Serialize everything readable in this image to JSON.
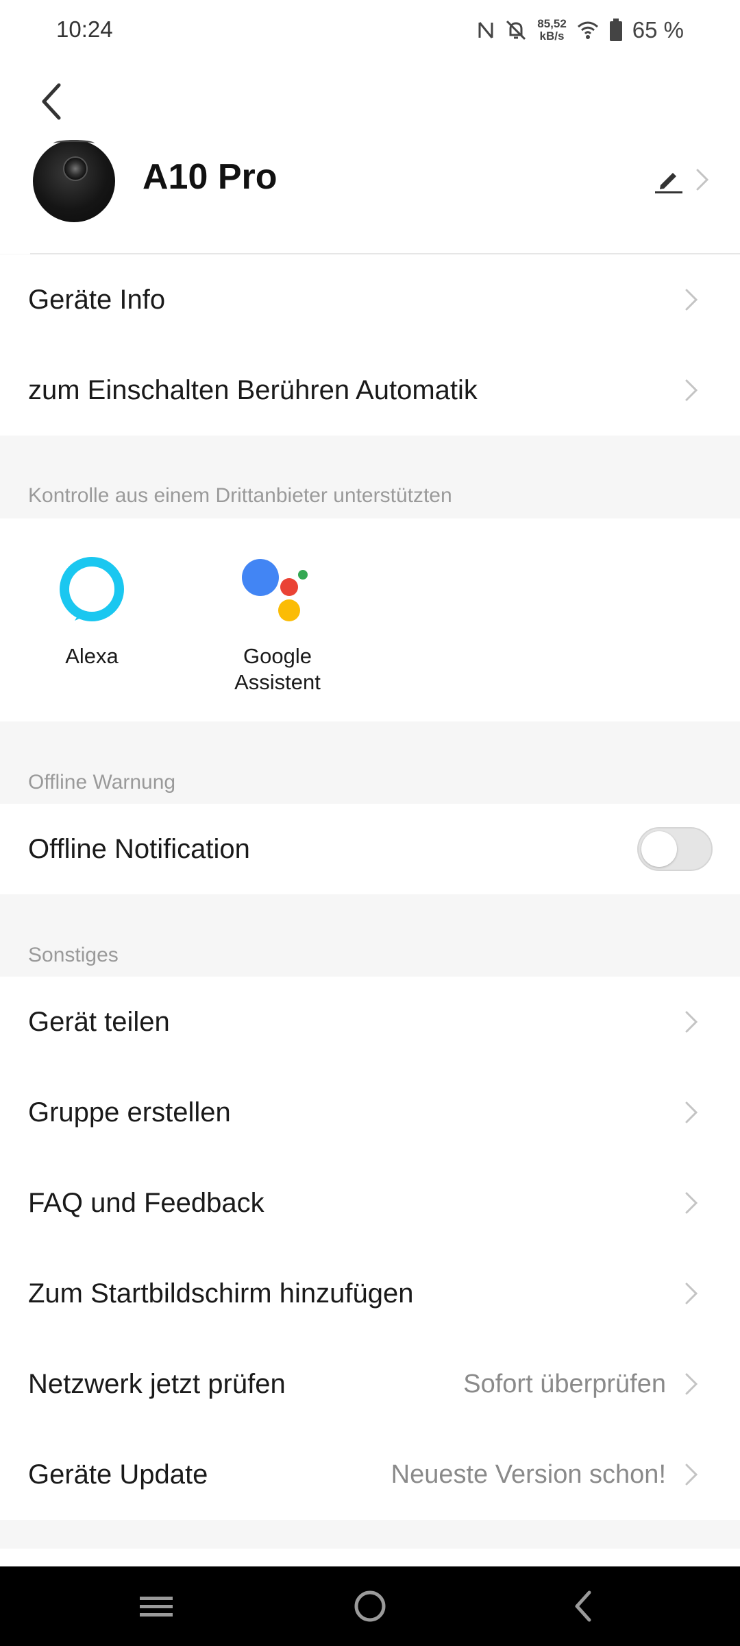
{
  "status_bar": {
    "time": "10:24",
    "speed_value": "85,52",
    "speed_unit": "kB/s",
    "battery_percent": "65 %"
  },
  "header": {
    "device_name": "A10 Pro"
  },
  "menu_top": [
    {
      "label": "Geräte Info"
    },
    {
      "label": "zum Einschalten Berühren Automatik"
    }
  ],
  "third_party": {
    "section_title": "Kontrolle aus einem Drittanbieter unterstützten",
    "alexa_label": "Alexa",
    "google_label_line1": "Google",
    "google_label_line2": "Assistent"
  },
  "offline": {
    "section_title": "Offline Warnung",
    "notification_label": "Offline Notification",
    "enabled": false
  },
  "misc": {
    "section_title": "Sonstiges",
    "items": [
      {
        "label": "Gerät teilen",
        "value": ""
      },
      {
        "label": "Gruppe erstellen",
        "value": ""
      },
      {
        "label": "FAQ und Feedback",
        "value": ""
      },
      {
        "label": "Zum Startbildschirm hinzufügen",
        "value": ""
      },
      {
        "label": "Netzwerk jetzt prüfen",
        "value": "Sofort überprüfen"
      },
      {
        "label": "Geräte Update",
        "value": "Neueste Version schon!"
      }
    ]
  },
  "colors": {
    "alexa": "#1ac7f0",
    "google_blue": "#4285f4",
    "google_red": "#ea4335",
    "google_yellow": "#fbbc05",
    "google_green": "#34a853"
  }
}
